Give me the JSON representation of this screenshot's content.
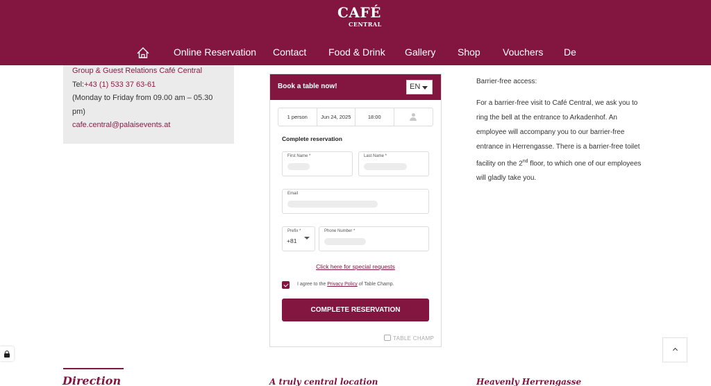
{
  "brand": {
    "logo_top": "CAFÉ",
    "logo_bottom": "CENTRAL",
    "color": "#821641"
  },
  "nav": {
    "home_icon": "home-icon",
    "items": [
      "Online Reservation",
      "Contact",
      "Food & Drink",
      "Gallery",
      "Shop",
      "Vouchers",
      "De"
    ]
  },
  "contact": {
    "heading": "Group & Guest Relations Café Central",
    "tel_label": "Tel:",
    "tel": "+43 (1) 533 37 63-61",
    "hours_line1": "(Monday to Friday from 09.00 am – 05.30",
    "hours_line2": "pm)",
    "email": "cafe.central@palaisevents.at"
  },
  "widget": {
    "title": "Book a table now!",
    "language": "EN",
    "party_size": "1 person",
    "date": "Jun 24, 2025",
    "time": "18:00",
    "subtitle": "Complete reservation",
    "first_name_label": "First Name *",
    "last_name_label": "Last Name *",
    "email_label": "Email",
    "prefix_label": "Prefix *",
    "prefix_value": "+81",
    "phone_label": "Phone Number *",
    "special_requests": "Click here for special requests",
    "agree_before": "I agree to the",
    "privacy_link": "Privacy Policy",
    "agree_after": "of Table Champ.",
    "checkbox_checked": true,
    "complete_button": "COMPLETE RESERVATION",
    "powered_by": "TABLE CHAMP"
  },
  "barrier_free": {
    "title": "Barrier-free access:",
    "text_part1": "For a barrier-free visit to Café Central, we ask you to ring the bell at the entrance to Arkadenhof. An employee will accompany you to our barrier-free entrance in Herrengasse. There is a barrier-free toilet facility on the 2",
    "sup": "nd",
    "text_part2": " floor, to which one of our employees will gladly take you."
  },
  "footer_headings": [
    "Direction",
    "A truly central location",
    "Heavenly Herrengasse"
  ]
}
